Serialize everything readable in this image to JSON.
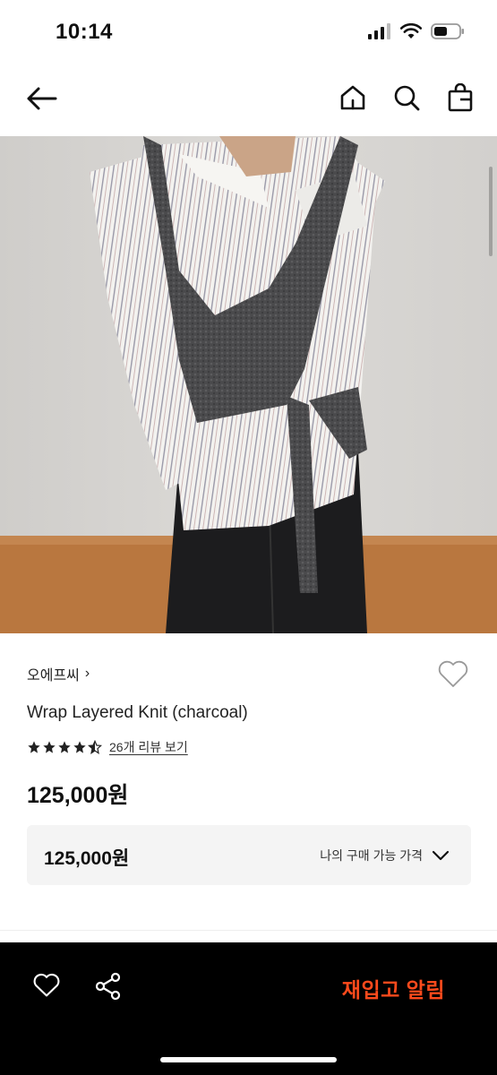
{
  "status_bar": {
    "time": "10:14",
    "icons": [
      "signal-icon",
      "wifi-icon",
      "battery-icon"
    ]
  },
  "header": {
    "back_icon": "arrow-left-icon",
    "actions": [
      "home-icon",
      "search-icon",
      "shopping-bag-icon"
    ]
  },
  "product": {
    "brand": "오에프씨",
    "brand_chevron": "›",
    "name": "Wrap Layered Knit (charcoal)",
    "rating": 4.5,
    "review_link": "26개 리뷰 보기",
    "price": "125,000원",
    "wishlist_icon": "heart-outline-icon"
  },
  "my_price": {
    "value": "125,000원",
    "label": "나의 구매 가능 가격",
    "expand_icon": "chevron-down-icon"
  },
  "bottom_bar": {
    "wishlist_icon": "heart-outline-icon",
    "share_icon": "share-icon",
    "restock_label": "재입고 알림"
  },
  "colors": {
    "accent": "#ff4a1c",
    "bottom_bar_bg": "#000000",
    "price_box_bg": "#f4f4f4"
  }
}
